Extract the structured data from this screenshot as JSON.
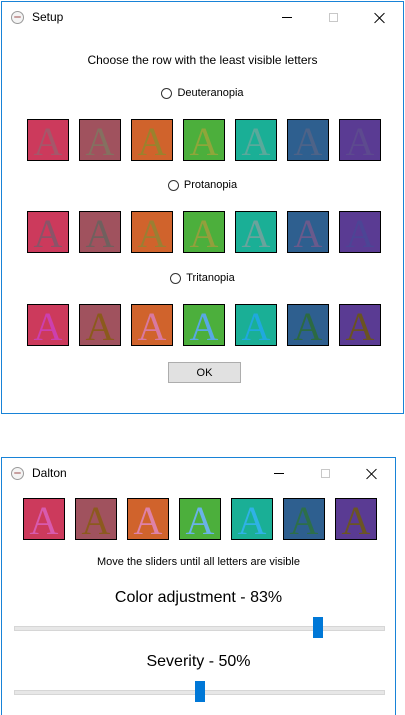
{
  "setup_window": {
    "title": "Setup",
    "instruction": "Choose the row with the least visible letters",
    "letter": "A",
    "rows": [
      {
        "label": "Deuteranopia",
        "swatches": [
          {
            "bg": "#cc3a5c",
            "fg": "#a5576a"
          },
          {
            "bg": "#a0525e",
            "fg": "#857060"
          },
          {
            "bg": "#d0632c",
            "fg": "#9a822d"
          },
          {
            "bg": "#4caf3c",
            "fg": "#8fa63a"
          },
          {
            "bg": "#1aaf96",
            "fg": "#5aa99b"
          },
          {
            "bg": "#2e5f8f",
            "fg": "#4d6388"
          },
          {
            "bg": "#5a3b93",
            "fg": "#5d4a8f"
          }
        ]
      },
      {
        "label": "Protanopia",
        "swatches": [
          {
            "bg": "#cc3a5c",
            "fg": "#8a5468"
          },
          {
            "bg": "#a0525e",
            "fg": "#70605e"
          },
          {
            "bg": "#d0632c",
            "fg": "#9a7f33"
          },
          {
            "bg": "#4caf3c",
            "fg": "#939f3c"
          },
          {
            "bg": "#1aaf96",
            "fg": "#6aa39c"
          },
          {
            "bg": "#2e5f8f",
            "fg": "#6a5a8c"
          },
          {
            "bg": "#5a3b93",
            "fg": "#4c4595"
          }
        ]
      },
      {
        "label": "Tritanopia",
        "swatches": [
          {
            "bg": "#cc3a5c",
            "fg": "#cc3faf"
          },
          {
            "bg": "#a0525e",
            "fg": "#8b5a1c"
          },
          {
            "bg": "#d0632c",
            "fg": "#d879a0"
          },
          {
            "bg": "#4caf3c",
            "fg": "#58a8e4"
          },
          {
            "bg": "#1aaf96",
            "fg": "#1fa9de"
          },
          {
            "bg": "#2e5f8f",
            "fg": "#2c6a42"
          },
          {
            "bg": "#5a3b93",
            "fg": "#6a5320"
          }
        ]
      }
    ],
    "ok_label": "OK"
  },
  "dalton_window": {
    "title": "Dalton",
    "letter": "A",
    "swatches": [
      {
        "bg": "#cc3a5c",
        "fg": "#d85aae"
      },
      {
        "bg": "#a0525e",
        "fg": "#8c5a1e"
      },
      {
        "bg": "#d0632c",
        "fg": "#de82a8"
      },
      {
        "bg": "#4caf3c",
        "fg": "#6ab2e8"
      },
      {
        "bg": "#1aaf96",
        "fg": "#2fb2e6"
      },
      {
        "bg": "#2e5f8f",
        "fg": "#2d6f4a"
      },
      {
        "bg": "#5a3b93",
        "fg": "#6b5524"
      }
    ],
    "hint": "Move the sliders until all letters are visible",
    "color_adjustment_label": "Color adjustment - 83%",
    "color_adjustment_value": 83,
    "severity_label": "Severity - 50%",
    "severity_value": 50
  },
  "colors": {
    "window_border": "#1883d7",
    "slider_thumb": "#0078d7",
    "button_bg": "#e1e1e1"
  }
}
